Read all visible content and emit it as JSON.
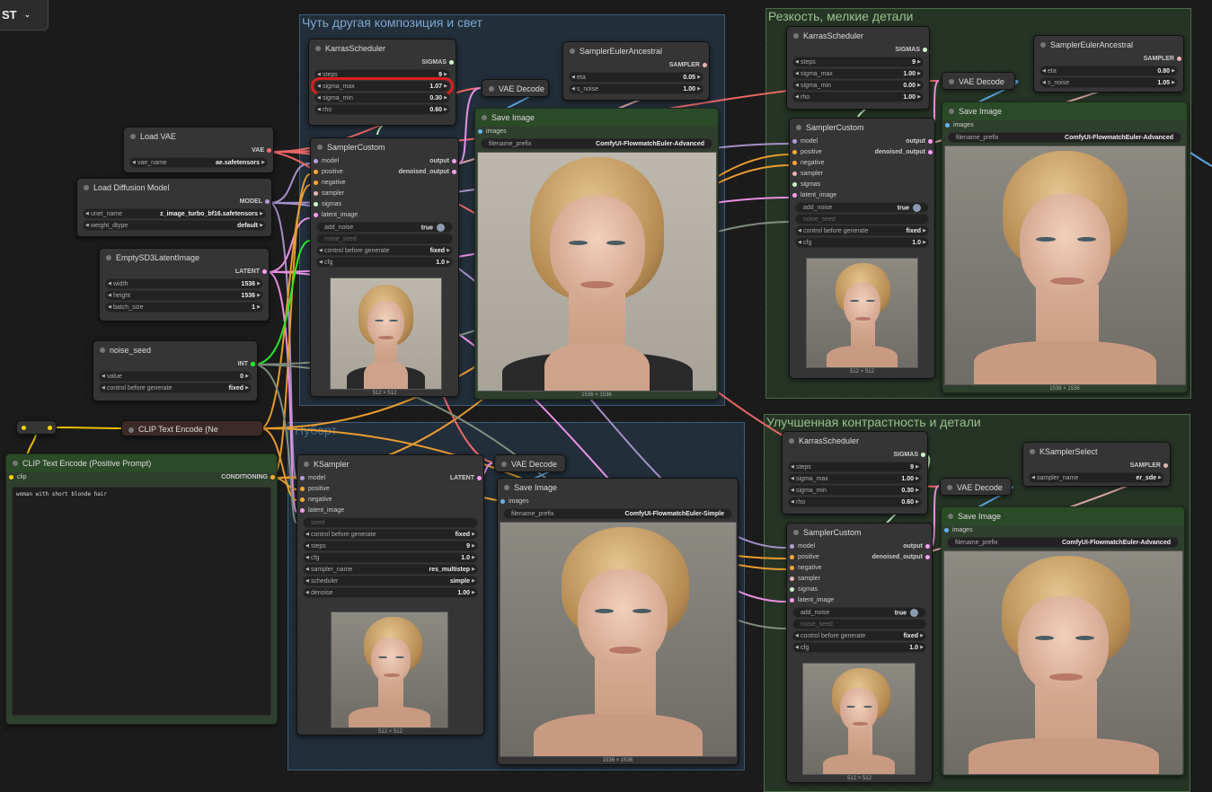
{
  "app": {
    "menu_label": "ST",
    "menu_icon": "chevron-down-icon"
  },
  "colors": {
    "clip": "#ffd500",
    "conditioning": "#ffa931",
    "latent": "#ff9cf9",
    "model": "#b39ddb",
    "sigmas": "#cdffcd",
    "sampler": "#ecb4b4",
    "vae": "#ff6e6e",
    "int": "#29ff29",
    "image": "#64b5f6"
  },
  "groups": {
    "g1": "Чуть другая композиция и свет",
    "g2": "Резкость, мелкие детали",
    "g3": "Улучшенная контрастность и  детали",
    "g4": "\"Нуборт"
  },
  "load_vae": {
    "title": "Load VAE",
    "out": "VAE",
    "w_label": "vae_name",
    "w_value": "ae.safetensors"
  },
  "load_model": {
    "title": "Load Diffusion Model",
    "out": "MODEL",
    "unet_label": "unet_name",
    "unet_value": "z_image_turbo_bf16.safetensors",
    "dtype_label": "weight_dtype",
    "dtype_value": "default"
  },
  "latent": {
    "title": "EmptySD3LatentImage",
    "out": "LATENT",
    "width_label": "width",
    "width": "1536",
    "height_label": "height",
    "height": "1536",
    "batch_label": "batch_size",
    "batch": "1"
  },
  "noise": {
    "title": "noise_seed",
    "out": "INT",
    "value_label": "value",
    "value": "0",
    "control_label": "control before generate",
    "control": "fixed"
  },
  "clip_neg": {
    "title": "CLIP Text Encode (Ne"
  },
  "clip_pos": {
    "title": "CLIP Text Encode (Positive Prompt)",
    "in": "clip",
    "out": "CONDITIONING",
    "text": "woman with short blonde hair"
  },
  "k1": {
    "title": "KarrasScheduler",
    "out": "SIGMAS",
    "steps_label": "steps",
    "steps": "9",
    "smax_label": "sigma_max",
    "smax": "1.07",
    "smin_label": "sigma_min",
    "smin": "0.30",
    "rho_label": "rho",
    "rho": "0.60"
  },
  "sea1": {
    "title": "SamplerEulerAncestral",
    "out": "SAMPLER",
    "eta_label": "eta",
    "eta": "0.05",
    "sn_label": "s_noise",
    "sn": "1.00"
  },
  "vae1": {
    "title": "VAE Decode"
  },
  "sc1": {
    "title": "SamplerCustom",
    "in": [
      "model",
      "positive",
      "negative",
      "sampler",
      "sigmas",
      "latent_image"
    ],
    "out1": "output",
    "out2": "denoised_output",
    "add_noise_label": "add_noise",
    "add_noise": "true",
    "seed_label": "noise_seed",
    "control_label": "control before generate",
    "control": "fixed",
    "cfg_label": "cfg",
    "cfg": "1.0",
    "size": "512 × 512"
  },
  "save1": {
    "title": "Save Image",
    "in": "images",
    "prefix_label": "filename_prefix",
    "prefix": "ComfyUI-FlowmatchEuler-Advanced",
    "size": "1536 × 1536"
  },
  "k2": {
    "title": "KarrasScheduler",
    "out": "SIGMAS",
    "steps_label": "steps",
    "steps": "9",
    "smax_label": "sigma_max",
    "smax": "1.00",
    "smin_label": "sigma_min",
    "smin": "0.00",
    "rho_label": "rho",
    "rho": "1.00"
  },
  "sea2": {
    "title": "SamplerEulerAncestral",
    "out": "SAMPLER",
    "eta_label": "eta",
    "eta": "0.80",
    "sn_label": "s_noise",
    "sn": "1.05"
  },
  "vae2": {
    "title": "VAE Decode"
  },
  "sc2": {
    "title": "SamplerCustom",
    "in": [
      "model",
      "positive",
      "negative",
      "sampler",
      "sigmas",
      "latent_image"
    ],
    "out1": "output",
    "out2": "denoised_output",
    "add_noise_label": "add_noise",
    "add_noise": "true",
    "seed_label": "noise_seed",
    "control_label": "control before generate",
    "control": "fixed",
    "cfg_label": "cfg",
    "cfg": "1.0",
    "size": "512 × 512"
  },
  "save2": {
    "title": "Save Image",
    "in": "images",
    "prefix_label": "filename_prefix",
    "prefix": "ComfyUI-FlowmatchEuler-Advanced",
    "size": "1536 × 1536"
  },
  "ks": {
    "title": "KSampler",
    "in": [
      "model",
      "positive",
      "negative",
      "latent_image"
    ],
    "out": "LATENT",
    "seed_label": "seed",
    "control_label": "control before generate",
    "control": "fixed",
    "steps_label": "steps",
    "steps": "9",
    "cfg_label": "cfg",
    "cfg": "1.0",
    "sampler_label": "sampler_name",
    "sampler": "res_multistep",
    "sched_label": "scheduler",
    "sched": "simple",
    "denoise_label": "denoise",
    "denoise": "1.00",
    "size": "512 × 512"
  },
  "vae4": {
    "title": "VAE Decode"
  },
  "save4": {
    "title": "Save Image",
    "in": "images",
    "prefix_label": "filename_prefix",
    "prefix": "ComfyUI-FlowmatchEuler-Simple",
    "size": "1536 × 1536"
  },
  "k3": {
    "title": "KarrasScheduler",
    "out": "SIGMAS",
    "steps_label": "steps",
    "steps": "9",
    "smax_label": "sigma_max",
    "smax": "1.00",
    "smin_label": "sigma_min",
    "smin": "0.30",
    "rho_label": "rho",
    "rho": "0.60"
  },
  "kss": {
    "title": "KSamplerSelect",
    "out": "SAMPLER",
    "sampler_label": "sampler_name",
    "sampler": "er_sde"
  },
  "vae3": {
    "title": "VAE Decode"
  },
  "sc3": {
    "title": "SamplerCustom",
    "in": [
      "model",
      "positive",
      "negative",
      "sampler",
      "sigmas",
      "latent_image"
    ],
    "out1": "output",
    "out2": "denoised_output",
    "add_noise_label": "add_noise",
    "add_noise": "true",
    "seed_label": "noise_seed",
    "control_label": "control before generate",
    "control": "fixed",
    "cfg_label": "cfg",
    "cfg": "1.0",
    "size": "512 × 512"
  },
  "save3": {
    "title": "Save Image",
    "in": "images",
    "prefix_label": "filename_prefix",
    "prefix": "ComfyUI-FlowmatchEuler-Advanced",
    "size": "1536 × 1536"
  }
}
